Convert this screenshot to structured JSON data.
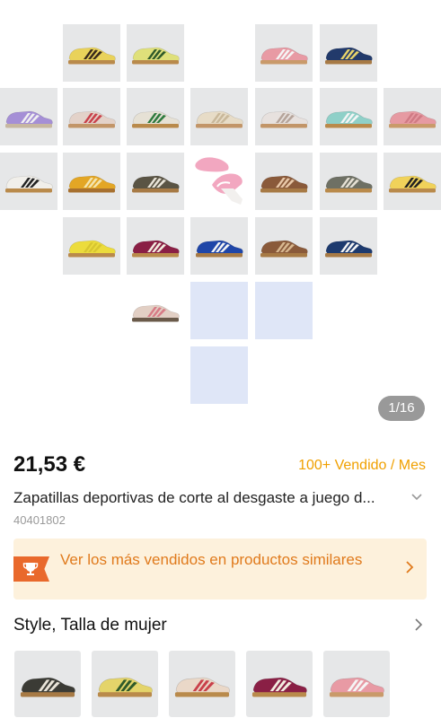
{
  "gallery": {
    "counter": "1/16",
    "shoes": [
      {
        "body": "#e9d25a",
        "stripe": "#3a2a1c",
        "sole": "#b98a4b"
      },
      {
        "body": "#dfe07a",
        "stripe": "#2f5a2a",
        "sole": "#b98a4b"
      },
      {
        "body": "#e89aa4",
        "stripe": "#f5f5f5",
        "sole": "#c99a6a"
      },
      {
        "body": "#223a6b",
        "stripe": "#e8d46a",
        "sole": "#a77a45"
      },
      {
        "body": "#a58fd6",
        "stripe": "#f1f1f1",
        "sole": "#c7b7a0"
      },
      {
        "body": "#e3d2c9",
        "stripe": "#c9404a",
        "sole": "#c29568"
      },
      {
        "body": "#e6e1d5",
        "stripe": "#2e7a3e",
        "sole": "#b98a4b"
      },
      {
        "body": "#e7dcc7",
        "stripe": "#c9b89a",
        "sole": "#c29568"
      },
      {
        "body": "#e7e1de",
        "stripe": "#b5a49a",
        "sole": "#c29568"
      },
      {
        "body": "#8fd0c8",
        "stripe": "#f5f5f5",
        "sole": "#b98a4b"
      },
      {
        "body": "#e69aa2",
        "stripe": "#d07a84",
        "sole": "#c99a6a"
      },
      {
        "body": "#f1efea",
        "stripe": "#222222",
        "sole": "#b98a4b"
      },
      {
        "body": "#e3a625",
        "stripe": "#f3e5b0",
        "sole": "#a7702f"
      },
      {
        "body": "#5a5444",
        "stripe": "#e9e4d8",
        "sole": "#a77a45"
      },
      {
        "body": "#f2a7c0",
        "stripe": "#ffffff",
        "sole": "#d58ea6"
      },
      {
        "body": "#8a5a3a",
        "stripe": "#e8c8a8",
        "sole": "#a77a45"
      },
      {
        "body": "#6e7064",
        "stripe": "#e6e1d5",
        "sole": "#b98a4b"
      },
      {
        "body": "#f0d25a",
        "stripe": "#222222",
        "sole": "#b98a4b"
      },
      {
        "body": "#ecdc3c",
        "stripe": "#d8c630",
        "sole": "#b98a4b"
      },
      {
        "body": "#8a1f45",
        "stripe": "#f3ede0",
        "sole": "#b98a4b"
      },
      {
        "body": "#1f46a8",
        "stripe": "#f5f5f5",
        "sole": "#a77a45"
      },
      {
        "body": "#8a5a3a",
        "stripe": "#d8b890",
        "sole": "#a77a45"
      },
      {
        "body": "#1d3a6e",
        "stripe": "#f5f5f5",
        "sole": "#a77a45"
      },
      {
        "body": "#e2cfc4",
        "stripe": "#d77b86",
        "sole": "#6a5a4a"
      }
    ],
    "variants": [
      {
        "body": "#3b3b35",
        "stripe": "#e9e4d8",
        "sole": "#a77a45"
      },
      {
        "body": "#e4d46a",
        "stripe": "#2f5a2a",
        "sole": "#b98a4b"
      },
      {
        "body": "#ead8c8",
        "stripe": "#c9404a",
        "sole": "#b98a4b"
      },
      {
        "body": "#8a1f45",
        "stripe": "#f3ede0",
        "sole": "#b98a4b"
      },
      {
        "body": "#e89aa4",
        "stripe": "#f5f5f5",
        "sole": "#c99a6a"
      }
    ]
  },
  "product": {
    "price": "21,53 €",
    "sold": "100+ Vendido / Mes",
    "title": "Zapatillas deportivas de corte al desgaste a juego d...",
    "id": "40401802"
  },
  "banner": {
    "text": "Ver los más vendidos en productos similares",
    "icon": "trophy-icon"
  },
  "style_section": {
    "label": "Style, Talla de mujer"
  },
  "icons": {
    "expand": "chevron-down-icon",
    "more": "chevron-right-icon"
  },
  "colors": {
    "accent": "#e07a1c",
    "sold": "#f0a000",
    "banner_bg": "#fdf1dc",
    "placeholder": "#dfe6f7"
  }
}
